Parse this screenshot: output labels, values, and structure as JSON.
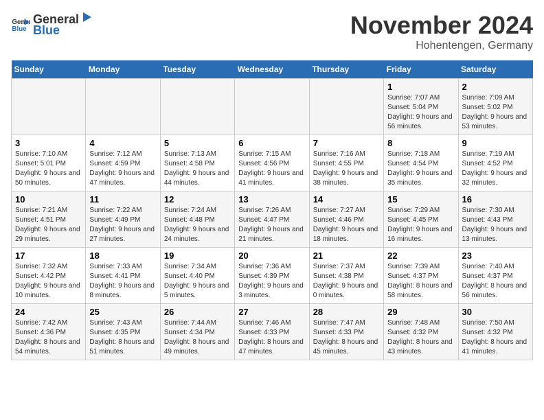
{
  "logo": {
    "text_general": "General",
    "text_blue": "Blue"
  },
  "title": "November 2024",
  "subtitle": "Hohentengen, Germany",
  "days_of_week": [
    "Sunday",
    "Monday",
    "Tuesday",
    "Wednesday",
    "Thursday",
    "Friday",
    "Saturday"
  ],
  "weeks": [
    [
      {
        "day": "",
        "info": ""
      },
      {
        "day": "",
        "info": ""
      },
      {
        "day": "",
        "info": ""
      },
      {
        "day": "",
        "info": ""
      },
      {
        "day": "",
        "info": ""
      },
      {
        "day": "1",
        "info": "Sunrise: 7:07 AM\nSunset: 5:04 PM\nDaylight: 9 hours and 56 minutes."
      },
      {
        "day": "2",
        "info": "Sunrise: 7:09 AM\nSunset: 5:02 PM\nDaylight: 9 hours and 53 minutes."
      }
    ],
    [
      {
        "day": "3",
        "info": "Sunrise: 7:10 AM\nSunset: 5:01 PM\nDaylight: 9 hours and 50 minutes."
      },
      {
        "day": "4",
        "info": "Sunrise: 7:12 AM\nSunset: 4:59 PM\nDaylight: 9 hours and 47 minutes."
      },
      {
        "day": "5",
        "info": "Sunrise: 7:13 AM\nSunset: 4:58 PM\nDaylight: 9 hours and 44 minutes."
      },
      {
        "day": "6",
        "info": "Sunrise: 7:15 AM\nSunset: 4:56 PM\nDaylight: 9 hours and 41 minutes."
      },
      {
        "day": "7",
        "info": "Sunrise: 7:16 AM\nSunset: 4:55 PM\nDaylight: 9 hours and 38 minutes."
      },
      {
        "day": "8",
        "info": "Sunrise: 7:18 AM\nSunset: 4:54 PM\nDaylight: 9 hours and 35 minutes."
      },
      {
        "day": "9",
        "info": "Sunrise: 7:19 AM\nSunset: 4:52 PM\nDaylight: 9 hours and 32 minutes."
      }
    ],
    [
      {
        "day": "10",
        "info": "Sunrise: 7:21 AM\nSunset: 4:51 PM\nDaylight: 9 hours and 29 minutes."
      },
      {
        "day": "11",
        "info": "Sunrise: 7:22 AM\nSunset: 4:49 PM\nDaylight: 9 hours and 27 minutes."
      },
      {
        "day": "12",
        "info": "Sunrise: 7:24 AM\nSunset: 4:48 PM\nDaylight: 9 hours and 24 minutes."
      },
      {
        "day": "13",
        "info": "Sunrise: 7:26 AM\nSunset: 4:47 PM\nDaylight: 9 hours and 21 minutes."
      },
      {
        "day": "14",
        "info": "Sunrise: 7:27 AM\nSunset: 4:46 PM\nDaylight: 9 hours and 18 minutes."
      },
      {
        "day": "15",
        "info": "Sunrise: 7:29 AM\nSunset: 4:45 PM\nDaylight: 9 hours and 16 minutes."
      },
      {
        "day": "16",
        "info": "Sunrise: 7:30 AM\nSunset: 4:43 PM\nDaylight: 9 hours and 13 minutes."
      }
    ],
    [
      {
        "day": "17",
        "info": "Sunrise: 7:32 AM\nSunset: 4:42 PM\nDaylight: 9 hours and 10 minutes."
      },
      {
        "day": "18",
        "info": "Sunrise: 7:33 AM\nSunset: 4:41 PM\nDaylight: 9 hours and 8 minutes."
      },
      {
        "day": "19",
        "info": "Sunrise: 7:34 AM\nSunset: 4:40 PM\nDaylight: 9 hours and 5 minutes."
      },
      {
        "day": "20",
        "info": "Sunrise: 7:36 AM\nSunset: 4:39 PM\nDaylight: 9 hours and 3 minutes."
      },
      {
        "day": "21",
        "info": "Sunrise: 7:37 AM\nSunset: 4:38 PM\nDaylight: 9 hours and 0 minutes."
      },
      {
        "day": "22",
        "info": "Sunrise: 7:39 AM\nSunset: 4:37 PM\nDaylight: 8 hours and 58 minutes."
      },
      {
        "day": "23",
        "info": "Sunrise: 7:40 AM\nSunset: 4:37 PM\nDaylight: 8 hours and 56 minutes."
      }
    ],
    [
      {
        "day": "24",
        "info": "Sunrise: 7:42 AM\nSunset: 4:36 PM\nDaylight: 8 hours and 54 minutes."
      },
      {
        "day": "25",
        "info": "Sunrise: 7:43 AM\nSunset: 4:35 PM\nDaylight: 8 hours and 51 minutes."
      },
      {
        "day": "26",
        "info": "Sunrise: 7:44 AM\nSunset: 4:34 PM\nDaylight: 8 hours and 49 minutes."
      },
      {
        "day": "27",
        "info": "Sunrise: 7:46 AM\nSunset: 4:33 PM\nDaylight: 8 hours and 47 minutes."
      },
      {
        "day": "28",
        "info": "Sunrise: 7:47 AM\nSunset: 4:33 PM\nDaylight: 8 hours and 45 minutes."
      },
      {
        "day": "29",
        "info": "Sunrise: 7:48 AM\nSunset: 4:32 PM\nDaylight: 8 hours and 43 minutes."
      },
      {
        "day": "30",
        "info": "Sunrise: 7:50 AM\nSunset: 4:32 PM\nDaylight: 8 hours and 41 minutes."
      }
    ]
  ]
}
